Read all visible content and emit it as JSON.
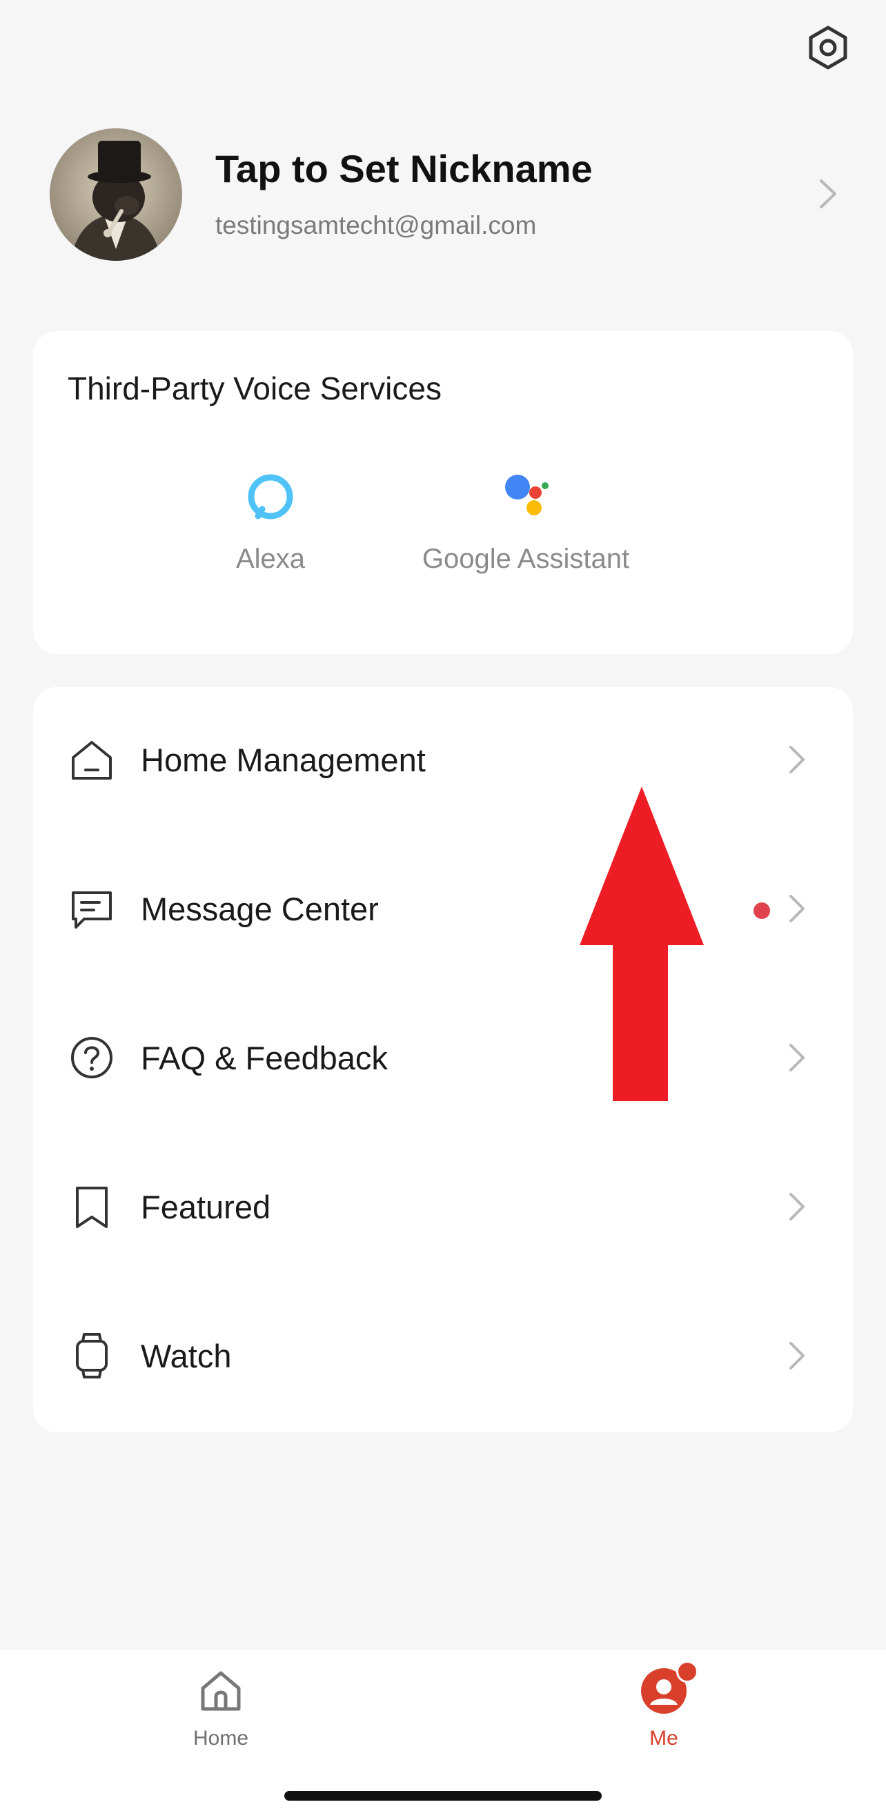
{
  "header": {
    "settings_icon": "gear-icon"
  },
  "profile": {
    "nickname": "Tap to Set Nickname",
    "email": "testingsamtecht@gmail.com"
  },
  "voice_services": {
    "title": "Third-Party Voice Services",
    "items": [
      {
        "label": "Alexa",
        "icon": "alexa-icon"
      },
      {
        "label": "Google Assistant",
        "icon": "google-assistant-icon"
      }
    ]
  },
  "menu": {
    "items": [
      {
        "label": "Home Management",
        "icon": "home-outline-icon"
      },
      {
        "label": "Message Center",
        "icon": "message-icon",
        "has_unread_dot": true
      },
      {
        "label": "FAQ & Feedback",
        "icon": "question-icon"
      },
      {
        "label": "Featured",
        "icon": "bookmark-icon"
      },
      {
        "label": "Watch",
        "icon": "watch-icon"
      }
    ]
  },
  "tabbar": {
    "tabs": [
      {
        "label": "Home",
        "icon": "home-tab-icon",
        "active": false
      },
      {
        "label": "Me",
        "icon": "me-tab-icon",
        "active": true,
        "has_badge": true
      }
    ]
  },
  "colors": {
    "background": "#f6f6f7",
    "card": "#ffffff",
    "accent": "#d9402b",
    "unread_dot": "#e0434b",
    "annotation_arrow": "#ee1c25",
    "alexa": "#4fc3f7",
    "muted_text": "#8a8a8a"
  }
}
